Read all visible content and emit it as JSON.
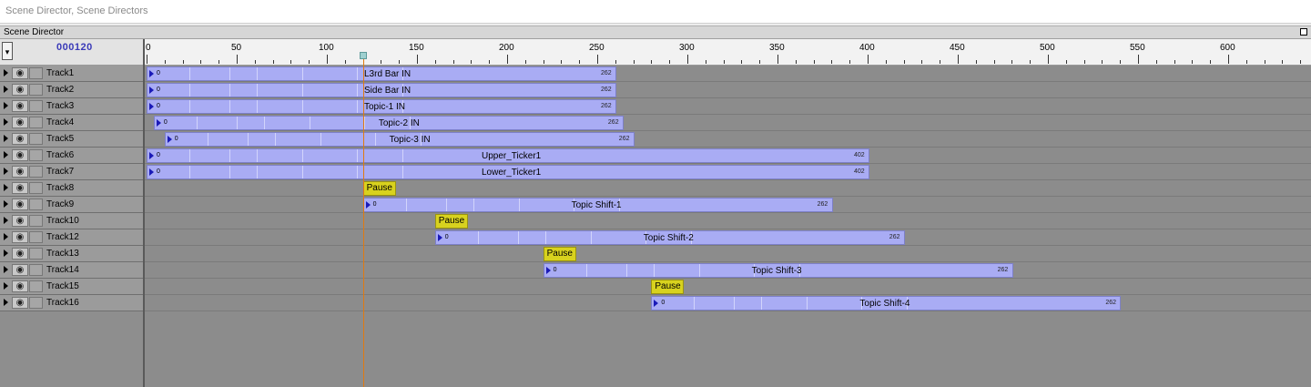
{
  "window": {
    "title": "Scene Director, Scene Directors"
  },
  "panel": {
    "title": "Scene Director"
  },
  "counter": "000120",
  "ruler": {
    "labels": [
      "0",
      "50",
      "100",
      "150",
      "200",
      "250",
      "300",
      "350",
      "400",
      "450",
      "500",
      "550",
      "600"
    ]
  },
  "playhead_frame": 120,
  "tracks": [
    {
      "name": "Track1",
      "clip": {
        "label": "L3rd Bar IN",
        "start": 0,
        "end_label": "262",
        "zero": "0"
      }
    },
    {
      "name": "Track2",
      "clip": {
        "label": "Side Bar IN",
        "start": 0,
        "end_label": "262",
        "zero": "0"
      }
    },
    {
      "name": "Track3",
      "clip": {
        "label": "Topic-1 IN",
        "start": 0,
        "end_label": "262",
        "zero": "0"
      }
    },
    {
      "name": "Track4",
      "clip": {
        "label": "Topic-2 IN",
        "start": 4,
        "end_label": "262",
        "zero": "0"
      }
    },
    {
      "name": "Track5",
      "clip": {
        "label": "Topic-3 IN",
        "start": 10,
        "end_label": "262",
        "zero": "0"
      }
    },
    {
      "name": "Track6",
      "clip": {
        "label": "Upper_Ticker1",
        "start": 0,
        "end_label": "402",
        "zero": "0"
      }
    },
    {
      "name": "Track7",
      "clip": {
        "label": "Lower_Ticker1",
        "start": 0,
        "end_label": "402",
        "zero": "0"
      }
    },
    {
      "name": "Track8",
      "pause": {
        "label": "Pause",
        "start": 120
      }
    },
    {
      "name": "Track9",
      "clip": {
        "label": "Topic Shift-1",
        "start": 120,
        "end_label": "262",
        "zero": "0"
      }
    },
    {
      "name": "Track10",
      "pause": {
        "label": "Pause",
        "start": 160
      }
    },
    {
      "name": "Track12",
      "clip": {
        "label": "Topic Shift-2",
        "start": 160,
        "end_label": "262",
        "zero": "0"
      }
    },
    {
      "name": "Track13",
      "pause": {
        "label": "Pause",
        "start": 220
      }
    },
    {
      "name": "Track14",
      "clip": {
        "label": "Topic Shift-3",
        "start": 220,
        "end_label": "262",
        "zero": "0"
      }
    },
    {
      "name": "Track15",
      "pause": {
        "label": "Pause",
        "start": 280
      }
    },
    {
      "name": "Track16",
      "clip": {
        "label": "Topic Shift-4",
        "start": 280,
        "end_label": "262",
        "zero": "0"
      }
    }
  ],
  "colors": {
    "clip": "#a9acf4",
    "pause": "#d8d21e",
    "playhead": "#e07a10",
    "counter": "#3a3ab8"
  }
}
